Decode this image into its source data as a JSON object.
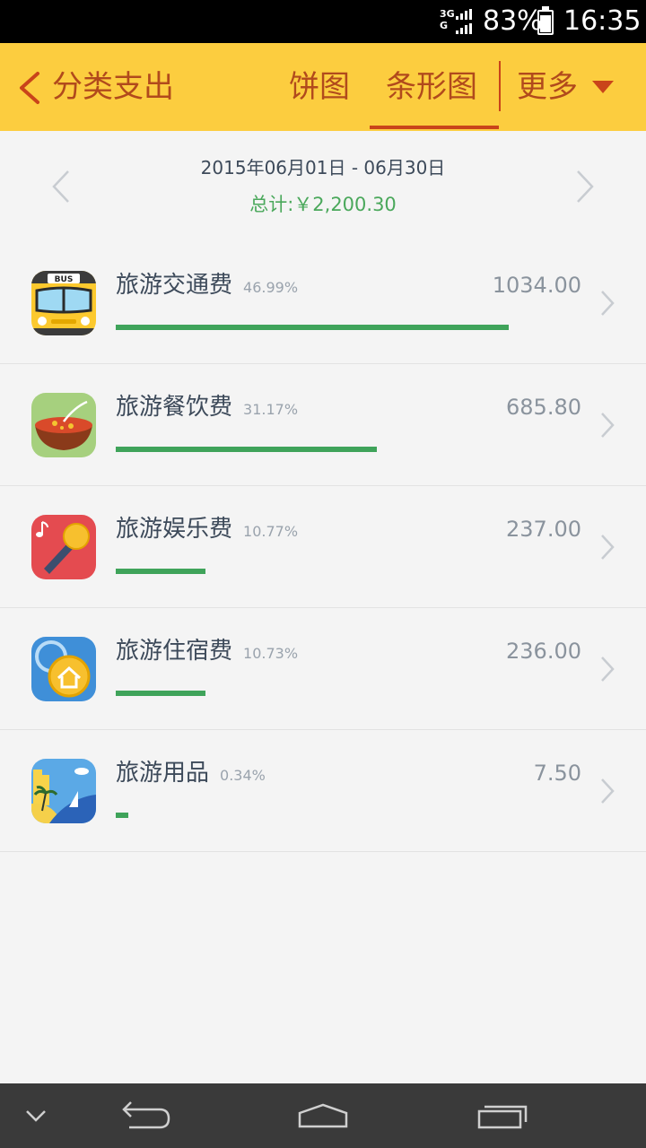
{
  "status_bar": {
    "network_top": "3G",
    "network_bottom": "G",
    "battery": "83%",
    "time": "16:35"
  },
  "header": {
    "title": "分类支出",
    "tabs": [
      {
        "label": "饼图",
        "active": false
      },
      {
        "label": "条形图",
        "active": true
      }
    ],
    "more_label": "更多"
  },
  "summary": {
    "date_range": "2015年06月01日 - 06月30日",
    "total": "总计:￥2,200.30"
  },
  "categories": [
    {
      "name": "旅游交通费",
      "percent": "46.99%",
      "amount": "1034.00",
      "share": 0.4699,
      "icon": "bus-icon"
    },
    {
      "name": "旅游餐饮费",
      "percent": "31.17%",
      "amount": "685.80",
      "share": 0.3117,
      "icon": "food-bowl-icon"
    },
    {
      "name": "旅游娱乐费",
      "percent": "10.77%",
      "amount": "237.00",
      "share": 0.1077,
      "icon": "microphone-icon"
    },
    {
      "name": "旅游住宿费",
      "percent": "10.73%",
      "amount": "236.00",
      "share": 0.1073,
      "icon": "house-coin-icon"
    },
    {
      "name": "旅游用品",
      "percent": "0.34%",
      "amount": "7.50",
      "share": 0.0034,
      "icon": "beach-icon"
    }
  ],
  "colors": {
    "accent": "#fccd3f",
    "header_text": "#b14a1c",
    "bar": "#3fa35a",
    "total_text": "#4aa85b"
  }
}
